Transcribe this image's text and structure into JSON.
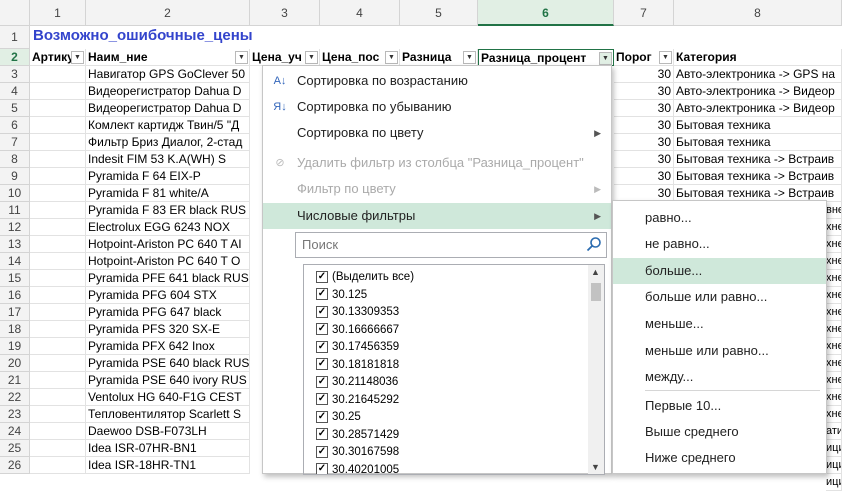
{
  "columns": [
    "1",
    "2",
    "3",
    "4",
    "5",
    "6",
    "7",
    "8"
  ],
  "rows": [
    "1",
    "2",
    "3",
    "4",
    "5",
    "6",
    "7",
    "8",
    "9",
    "10",
    "11",
    "12",
    "13",
    "14",
    "15",
    "16",
    "17",
    "18",
    "19",
    "20",
    "21",
    "22",
    "23",
    "24",
    "25",
    "26"
  ],
  "title": "Возможно_ошибочные_цены",
  "headers": [
    "Артику",
    "Наим_ние",
    "Цена_уч",
    "Цена_пос",
    "Разница",
    "Разница_процент",
    "Порог",
    "Категория"
  ],
  "names": [
    "Навигатор GPS GoClever 50",
    "Видеорегистратор Dahua D",
    "Видеорегистратор Dahua D",
    "Комлект картидж Твин/5 \"Д",
    "Фильтр Бриз Диалог, 2-стад",
    "Indesit FIM 53 K.A(WH) S",
    "Pyramida F 64 EIX-P",
    "Pyramida F 81 white/A",
    "Pyramida F 83 ER black RUS",
    "Electrolux EGG 6243 NOX",
    "Hotpoint-Ariston PC 640 T AI",
    "Hotpoint-Ariston PC 640 T O",
    "Pyramida PFE 641 black RUS",
    "Pyramida PFG 604 STX",
    "Pyramida PFG 647 black",
    "Pyramida PFS 320 SX-E",
    "Pyramida PFX 642 Inox",
    "Pyramida PSE 640 black RUS",
    "Pyramida PSE 640 ivory RUS",
    "Ventolux HG 640-F1G CEST",
    "Тепловентилятор Scarlett S",
    "Daewoo DSB-F073LH",
    "Idea ISR-07HR-BN1",
    "Idea ISR-18HR-TN1"
  ],
  "thresholds": [
    "30",
    "30",
    "30",
    "30",
    "30",
    "30",
    "30",
    "30"
  ],
  "categories": [
    "Авто-электроника -> GPS на",
    "Авто-электроника -> Видеор",
    "Авто-электроника -> Видеор",
    "Бытовая техника",
    "Бытовая техника",
    "Бытовая техника -> Встраив",
    "Бытовая техника -> Встраив",
    "Бытовая техника -> Встраив"
  ],
  "category_tails": [
    "вне",
    "хне",
    "хне",
    "хне",
    "хне",
    "хне",
    "хне",
    "хне",
    "хне",
    "хне",
    "хне",
    "хне",
    "хне",
    "ати",
    "ици",
    "ици",
    "ици"
  ],
  "menu": {
    "sort_asc": "Сортировка по возрастанию",
    "sort_desc": "Сортировка по убыванию",
    "sort_color": "Сортировка по цвету",
    "clear_filter": "Удалить фильтр из столбца \"Разница_процент\"",
    "filter_color": "Фильтр по цвету",
    "number_filters": "Числовые фильтры",
    "search_placeholder": "Поиск",
    "select_all": "(Выделить все)",
    "values": [
      "30.125",
      "30.13309353",
      "30.16666667",
      "30.17456359",
      "30.18181818",
      "30.21148036",
      "30.21645292",
      "30.25",
      "30.28571429",
      "30.30167598",
      "30.40201005"
    ]
  },
  "submenu": {
    "items": [
      "равно...",
      "не равно...",
      "больше...",
      "больше или равно...",
      "меньше...",
      "меньше или равно...",
      "между...",
      "Первые 10...",
      "Выше среднего",
      "Ниже среднего"
    ]
  },
  "colors": {
    "accent": "#217346",
    "highlight": "#cfe8da",
    "title": "#3344cc"
  }
}
